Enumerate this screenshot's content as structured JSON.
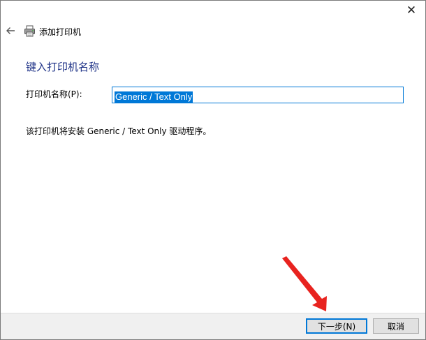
{
  "window": {
    "title": "添加打印机",
    "close_glyph": "✕"
  },
  "page": {
    "heading": "键入打印机名称",
    "name_label": "打印机名称(P):",
    "name_value": "Generic / Text Only",
    "driver_note": "该打印机将安装 Generic / Text Only 驱动程序。"
  },
  "footer": {
    "next_label": "下一步(N)",
    "cancel_label": "取消"
  },
  "icons": {
    "back": "back-arrow-icon",
    "printer": "printer-icon",
    "close": "close-icon"
  },
  "colors": {
    "heading": "#1e3287",
    "accent": "#0078d7",
    "annotation_arrow": "#e8231f"
  }
}
